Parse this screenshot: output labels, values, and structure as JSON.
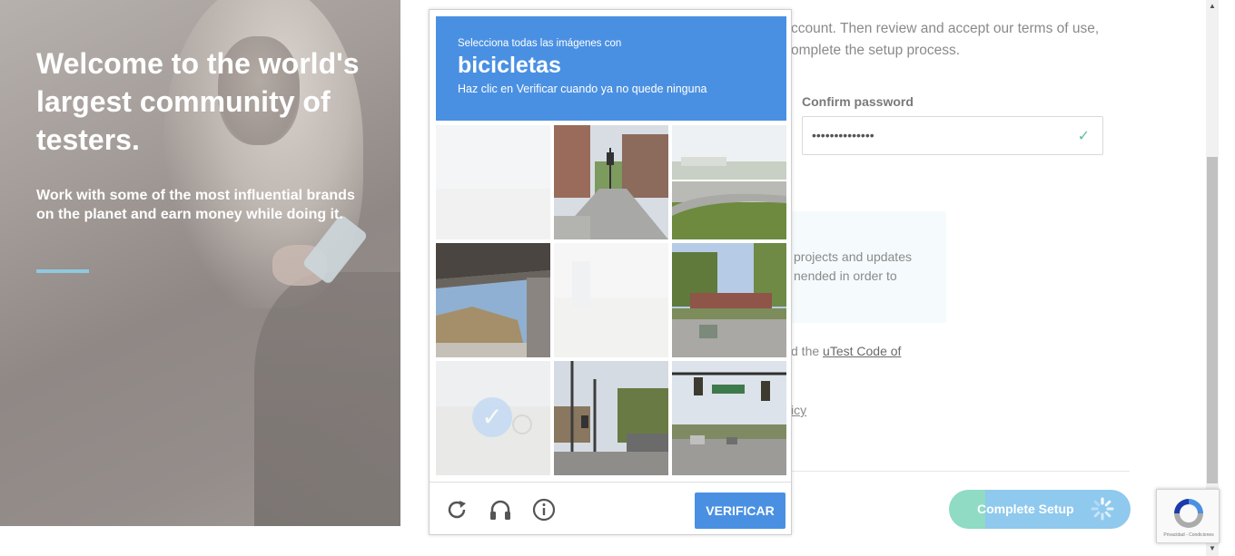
{
  "hero": {
    "title": "Welcome to the world's largest community of testers.",
    "subtitle": "Work with some of the most influential brands on the planet and earn money while doing it."
  },
  "form": {
    "intro_fragment_1": "ccount. Then review and accept our terms of use,",
    "intro_fragment_2": "omplete the setup process.",
    "confirm_password_label": "Confirm password",
    "confirm_password_value": "••••••••••••••",
    "info_fragment_1": " projects and updates",
    "info_fragment_2": "nended in order to",
    "code_fragment": "d the ",
    "code_link": "uTest Code of",
    "policy_fragment": "icy",
    "complete_setup_label": "Complete Setup"
  },
  "captcha": {
    "instruction": "Selecciona todas las imágenes con",
    "target": "bicicletas",
    "hint": "Haz clic en Verificar cuando ya no quede ninguna",
    "verify_label": "VERIFICAR",
    "accent_color": "#4a90e2"
  },
  "recaptcha_badge": {
    "legal": "Privacidad - Condiciones"
  }
}
